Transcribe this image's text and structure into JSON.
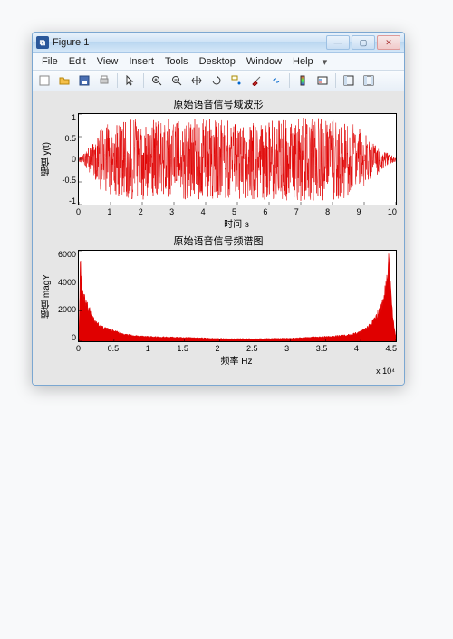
{
  "window": {
    "title": "Figure 1",
    "buttons": {
      "min": "—",
      "max": "▢",
      "close": "✕"
    }
  },
  "menu": [
    "File",
    "Edit",
    "View",
    "Insert",
    "Tools",
    "Desktop",
    "Window",
    "Help"
  ],
  "toolbar_icons": [
    "new",
    "open",
    "save",
    "print",
    "arrow",
    "zoom-in",
    "zoom-out",
    "pan",
    "rotate",
    "data-cursor",
    "brush",
    "link",
    "colorbar",
    "legend",
    "layout",
    "dock"
  ],
  "chart_data": [
    {
      "type": "line",
      "title": "原始语音信号域波形",
      "xlabel": "时间 s",
      "ylabel": "幅值 y(t)",
      "xlim": [
        0,
        10
      ],
      "ylim": [
        -1,
        1
      ],
      "xticks": [
        0,
        1,
        2,
        3,
        4,
        5,
        6,
        7,
        8,
        9,
        10
      ],
      "yticks": [
        -1,
        -0.5,
        0,
        0.5,
        1
      ],
      "description": "dense audio waveform oscillating roughly between -0.9 and 0.9 over 0–10 s",
      "envelope_approx": [
        [
          0,
          0.05
        ],
        [
          0.2,
          0.15
        ],
        [
          0.5,
          0.5
        ],
        [
          0.8,
          0.8
        ],
        [
          1.2,
          0.85
        ],
        [
          2,
          0.9
        ],
        [
          3,
          0.88
        ],
        [
          4,
          0.9
        ],
        [
          5,
          0.88
        ],
        [
          6,
          0.9
        ],
        [
          7,
          0.92
        ],
        [
          8,
          0.9
        ],
        [
          8.5,
          0.85
        ],
        [
          9,
          0.6
        ],
        [
          9.4,
          0.35
        ],
        [
          9.7,
          0.15
        ],
        [
          10,
          0.05
        ]
      ]
    },
    {
      "type": "line",
      "title": "原始语音信号频谱图",
      "xlabel": "频率 Hz",
      "ylabel": "幅值 magY",
      "xscale_label": "x 10⁴",
      "xlim": [
        0,
        4.5
      ],
      "ylim": [
        0,
        6000
      ],
      "xticks": [
        0,
        0.5,
        1,
        1.5,
        2,
        2.5,
        3,
        3.5,
        4,
        4.5
      ],
      "yticks": [
        0,
        2000,
        4000,
        6000
      ],
      "description": "magnitude spectrum with tall peaks near 0 Hz (~5000) and near 4.4e4 Hz (~5000), low (~200–500) in mid band",
      "samples": [
        [
          0,
          200
        ],
        [
          0.02,
          5000
        ],
        [
          0.05,
          3200
        ],
        [
          0.1,
          2600
        ],
        [
          0.15,
          2000
        ],
        [
          0.2,
          1500
        ],
        [
          0.3,
          1000
        ],
        [
          0.4,
          800
        ],
        [
          0.6,
          500
        ],
        [
          0.8,
          350
        ],
        [
          1,
          300
        ],
        [
          1.5,
          250
        ],
        [
          2,
          180
        ],
        [
          2.5,
          160
        ],
        [
          3,
          200
        ],
        [
          3.5,
          300
        ],
        [
          3.8,
          400
        ],
        [
          4,
          600
        ],
        [
          4.1,
          900
        ],
        [
          4.2,
          1400
        ],
        [
          4.3,
          2400
        ],
        [
          4.35,
          3400
        ],
        [
          4.4,
          5200
        ],
        [
          4.43,
          3200
        ],
        [
          4.46,
          1400
        ],
        [
          4.5,
          300
        ]
      ]
    }
  ]
}
